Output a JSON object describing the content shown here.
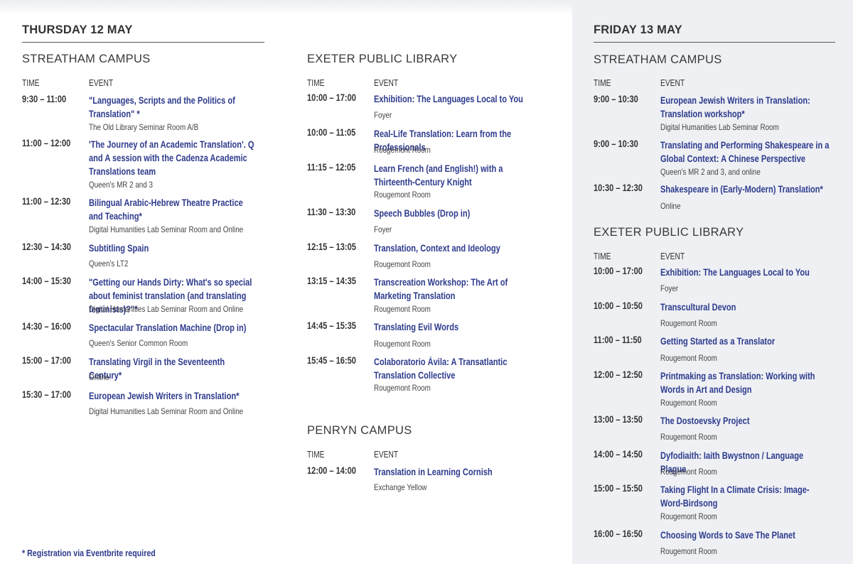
{
  "thursday": {
    "day": "THURSDAY 12 MAY",
    "streatham": {
      "campus": "STREATHAM CAMPUS",
      "time_header": "TIME",
      "event_header": "EVENT",
      "events": [
        {
          "time": "9:30 – 11:00",
          "title": "\"Languages, Scripts and the Politics of Translation\" *",
          "location": "The Old Library Seminar Room A/B"
        },
        {
          "time": "11:00 – 12:00",
          "title": "'The Journey of an Academic Translation'. Q and A session with the Cadenza Academic Translations team",
          "location": "Queen's MR 2 and 3"
        },
        {
          "time": "11:00 – 12:30",
          "title": "Bilingual Arabic-Hebrew Theatre Practice and Teaching*",
          "location": "Digital Humanities Lab Seminar Room and Online"
        },
        {
          "time": "12:30 – 14:30",
          "title": "Subtitling Spain",
          "location": "Queen's LT2"
        },
        {
          "time": "14:00 – 15:30",
          "title": "\"Getting our Hands Dirty: What's so special about feminist translation (and translating feminists)?\"*",
          "location": "Digital Humanities Lab Seminar Room and Online"
        },
        {
          "time": "14:30 – 16:00",
          "title": "Spectacular Translation Machine (Drop in)",
          "location": "Queen's Senior Common Room"
        },
        {
          "time": "15:00 – 17:00",
          "title": "Translating Virgil in the Seventeenth Century*",
          "location": "Online"
        },
        {
          "time": "15:30 – 17:00",
          "title": "European Jewish Writers in Translation*",
          "location": "Digital Humanities Lab Seminar Room and Online"
        }
      ]
    },
    "library": {
      "campus": "EXETER PUBLIC LIBRARY",
      "time_header": "TIME",
      "event_header": "EVENT",
      "events": [
        {
          "time": "10:00 – 17:00",
          "title": "Exhibition: The Languages Local to You",
          "location": "Foyer"
        },
        {
          "time": "10:00 – 11:05",
          "title": "Real-Life Translation: Learn from the Professionals",
          "location": "Rougemont Room"
        },
        {
          "time": "11:15 – 12:05",
          "title": "Learn French (and English!) with a Thirteenth-Century Knight",
          "location": "Rougemont Room"
        },
        {
          "time": "11:30 – 13:30",
          "title": "Speech Bubbles (Drop in)",
          "location": "Foyer"
        },
        {
          "time": "12:15 – 13:05",
          "title": "Translation, Context and Ideology",
          "location": "Rougemont Room"
        },
        {
          "time": "13:15 – 14:35",
          "title": "Transcreation Workshop: The Art of Marketing Translation",
          "location": "Rougemont Room"
        },
        {
          "time": "14:45 – 15:35",
          "title": "Translating Evil Words",
          "location": "Rougemont Room"
        },
        {
          "time": "15:45 – 16:50",
          "title": "Colaboratorio Ávila: A Transatlantic Translation Collective",
          "location": "Rougemont Room"
        }
      ]
    },
    "penryn": {
      "campus": "PENRYN CAMPUS",
      "time_header": "TIME",
      "event_header": "EVENT",
      "events": [
        {
          "time": "12:00 – 14:00",
          "title": "Translation in Learning Cornish",
          "location": "Exchange Yellow"
        }
      ]
    }
  },
  "friday": {
    "day": "FRIDAY 13 MAY",
    "streatham": {
      "campus": "STREATHAM CAMPUS",
      "time_header": "TIME",
      "event_header": "EVENT",
      "events": [
        {
          "time": "9:00 – 10:30",
          "title": "European Jewish Writers in Translation: Translation workshop*",
          "location": "Digital Humanities Lab Seminar Room"
        },
        {
          "time": "9:00 – 10:30",
          "title": "Translating and Performing Shakespeare in a Global Context: A Chinese Perspective",
          "location": "Queen's MR 2 and 3, and online"
        },
        {
          "time": "10:30 – 12:30",
          "title": "Shakespeare in (Early-Modern) Translation*",
          "location": "Online"
        }
      ]
    },
    "library": {
      "campus": "EXETER PUBLIC LIBRARY",
      "time_header": "TIME",
      "event_header": "EVENT",
      "events": [
        {
          "time": "10:00 – 17:00",
          "title": "Exhibition: The Languages Local to You",
          "location": "Foyer"
        },
        {
          "time": "10:00 – 10:50",
          "title": "Transcultural Devon",
          "location": "Rougemont Room"
        },
        {
          "time": "11:00 – 11:50",
          "title": "Getting Started as a Translator",
          "location": "Rougemont Room"
        },
        {
          "time": "12:00 – 12:50",
          "title": "Printmaking as Translation: Working with Words in Art and Design",
          "location": "Rougemont Room"
        },
        {
          "time": "13:00 – 13:50",
          "title": "The Dostoevsky Project",
          "location": "Rougemont Room"
        },
        {
          "time": "14:00 – 14:50",
          "title": "Dyfodiaith: Iaith Bwystnon / Language Plague",
          "location": "Rougemont Room"
        },
        {
          "time": "15:00 – 15:50",
          "title": "Taking Flight In a Climate Crisis: Image-Word-Birdsong",
          "location": "Rougemont Room"
        },
        {
          "time": "16:00 – 16:50",
          "title": "Choosing Words to Save The Planet",
          "location": "Rougemont Room"
        }
      ]
    }
  },
  "footnote": "* Registration via Eventbrite required",
  "colors": {
    "title": "#2d3a8c",
    "panel": "#eef0f4"
  }
}
